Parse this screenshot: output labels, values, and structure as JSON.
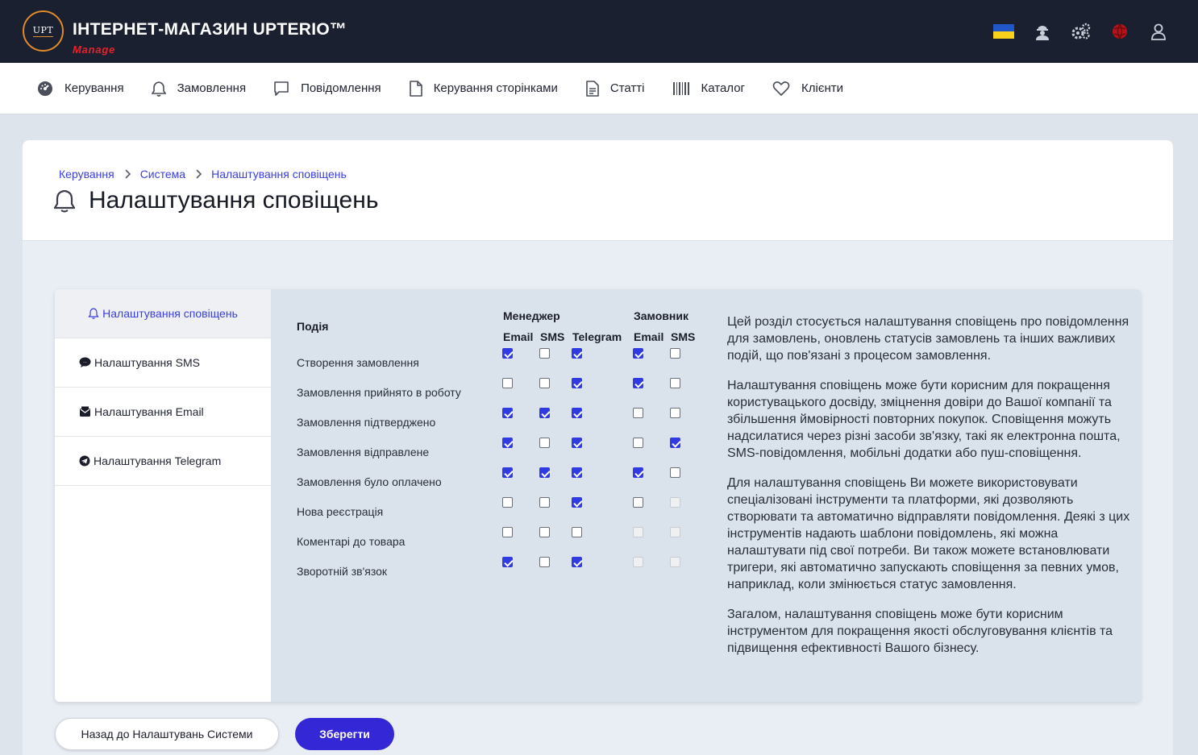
{
  "header": {
    "logo_text": "UPT",
    "title": "ІНТЕРНЕТ-МАГАЗИН UPTERIO™",
    "subtitle": "Manage"
  },
  "nav": {
    "items": [
      {
        "label": "Керування",
        "icon": "dashboard-icon"
      },
      {
        "label": "Замовлення",
        "icon": "bell-icon"
      },
      {
        "label": "Повідомлення",
        "icon": "message-icon"
      },
      {
        "label": "Керування сторінками",
        "icon": "page-icon"
      },
      {
        "label": "Статті",
        "icon": "article-icon"
      },
      {
        "label": "Каталог",
        "icon": "barcode-icon"
      },
      {
        "label": "Клієнти",
        "icon": "heart-icon"
      }
    ]
  },
  "breadcrumb": {
    "items": [
      "Керування",
      "Система",
      "Налаштування сповіщень"
    ]
  },
  "page_title": "Налаштування сповіщень",
  "sidebar": {
    "items": [
      {
        "label": "Налаштування сповіщень",
        "icon": "bell-icon",
        "active": true
      },
      {
        "label": "Налаштування SMS",
        "icon": "sms-icon",
        "active": false
      },
      {
        "label": "Налаштування Email",
        "icon": "email-icon",
        "active": false
      },
      {
        "label": "Налаштування Telegram",
        "icon": "telegram-icon",
        "active": false
      }
    ]
  },
  "grid": {
    "event_header": "Подія",
    "group_manager": "Менеджер",
    "group_customer": "Замовник",
    "channels": [
      "Email",
      "SMS",
      "Telegram",
      "Email",
      "SMS"
    ],
    "events": [
      {
        "label": "Створення замовлення",
        "checks": [
          true,
          false,
          true,
          true,
          false
        ],
        "disabled": [
          false,
          false,
          false,
          false,
          false
        ]
      },
      {
        "label": "Замовлення прийнято в роботу",
        "checks": [
          false,
          false,
          true,
          true,
          false
        ],
        "disabled": [
          false,
          false,
          false,
          false,
          false
        ]
      },
      {
        "label": "Замовлення підтверджено",
        "checks": [
          true,
          true,
          true,
          false,
          false
        ],
        "disabled": [
          false,
          false,
          false,
          false,
          false
        ]
      },
      {
        "label": "Замовлення відправлене",
        "checks": [
          true,
          false,
          true,
          false,
          true
        ],
        "disabled": [
          false,
          false,
          false,
          false,
          false
        ]
      },
      {
        "label": "Замовлення було оплачено",
        "checks": [
          true,
          true,
          true,
          true,
          false
        ],
        "disabled": [
          false,
          false,
          false,
          false,
          false
        ]
      },
      {
        "label": "Нова реєстрація",
        "checks": [
          false,
          false,
          true,
          false,
          false
        ],
        "disabled": [
          false,
          false,
          false,
          false,
          true
        ]
      },
      {
        "label": "Коментарі до товара",
        "checks": [
          false,
          false,
          false,
          false,
          false
        ],
        "disabled": [
          false,
          false,
          false,
          true,
          true
        ]
      },
      {
        "label": "Зворотній зв'язок",
        "checks": [
          true,
          false,
          true,
          false,
          false
        ],
        "disabled": [
          false,
          false,
          false,
          true,
          true
        ]
      }
    ]
  },
  "description": [
    "Цей розділ стосується налаштування сповіщень про повідомлення для замовлень, оновлень статусів замовлень та інших важливих подій, що пов'язані з процесом замовлення.",
    "Налаштування сповіщень може бути корисним для покращення користувацького досвіду, зміцнення довіри до Вашої компанії та збільшення ймовірності повторних покупок. Сповіщення можуть надсилатися через різні засоби зв'язку, такі як електронна пошта, SMS-повідомлення, мобільні додатки або пуш-сповіщення.",
    "Для налаштування сповіщень Ви можете використовувати спеціалізовані інструменти та платформи, які дозволяють створювати та автоматично відправляти повідомлення. Деякі з цих інструментів надають шаблони повідомлень, які можна налаштувати під свої потреби. Ви також можете встановлювати тригери, які автоматично запускають сповіщення за певних умов, наприклад, коли змінюється статус замовлення.",
    "Загалом, налаштування сповіщень може бути корисним інструментом для покращення якості обслуговування клієнтів та підвищення ефективності Вашого бізнесу."
  ],
  "buttons": {
    "back": "Назад до Налаштувань Системи",
    "save": "Зберегти"
  },
  "colors": {
    "header_bg": "#1b2030",
    "accent": "#3427d6",
    "link": "#3a3ee0",
    "brand_red": "#e5232b"
  }
}
